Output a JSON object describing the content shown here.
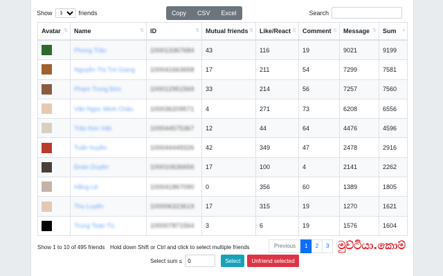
{
  "toolbar": {
    "show_label": "Show",
    "page_size": "10",
    "friends_label": "friends",
    "copy": "Copy",
    "csv": "CSV",
    "excel": "Excel",
    "search_label": "Search",
    "search_value": ""
  },
  "table": {
    "columns": [
      "Avatar",
      "Name",
      "ID",
      "Mutual friends",
      "Like/React",
      "Comment",
      "Message",
      "Sum"
    ],
    "rows": [
      {
        "avatar_color": "#2e6b2a",
        "name": "Phong Trần",
        "id": "100013367684",
        "mutual": "43",
        "like": "116",
        "comment": "19",
        "message": "9021",
        "sum": "9199"
      },
      {
        "avatar_color": "#a0612c",
        "name": "Nguyễn Thị Tơi Giang",
        "id": "100041663658",
        "mutual": "17",
        "like": "211",
        "comment": "54",
        "message": "7299",
        "sum": "7581"
      },
      {
        "avatar_color": "#8c5b3f",
        "name": "Phạm Trung Đức",
        "id": "100012951569",
        "mutual": "33",
        "like": "214",
        "comment": "56",
        "message": "7257",
        "sum": "7560"
      },
      {
        "avatar_color": "#e8c9b0",
        "name": "Văn Ngọc Minh Châu",
        "id": "100036209571",
        "mutual": "4",
        "like": "271",
        "comment": "73",
        "message": "6208",
        "sum": "6556"
      },
      {
        "avatar_color": "#d9d0c2",
        "name": "Trần Kim Việt",
        "id": "100044575367",
        "mutual": "12",
        "like": "44",
        "comment": "64",
        "message": "4476",
        "sum": "4596"
      },
      {
        "avatar_color": "#b83b2b",
        "name": "Tuấn huyền",
        "id": "100044449326",
        "mutual": "42",
        "like": "349",
        "comment": "47",
        "message": "2478",
        "sum": "2916"
      },
      {
        "avatar_color": "#4a4039",
        "name": "Đoàn Duyên",
        "id": "100010636656",
        "mutual": "17",
        "like": "100",
        "comment": "4",
        "message": "2141",
        "sum": "2262"
      },
      {
        "avatar_color": "#c5b3a8",
        "name": "Hằng Lê",
        "id": "100041867090",
        "mutual": "0",
        "like": "356",
        "comment": "60",
        "message": "1389",
        "sum": "1805"
      },
      {
        "avatar_color": "#e3c8b6",
        "name": "Thu Luyến",
        "id": "100006323619",
        "mutual": "17",
        "like": "315",
        "comment": "19",
        "message": "1270",
        "sum": "1621"
      },
      {
        "avatar_color": "#050505",
        "name": "Trung Toàn Tú",
        "id": "100007871564",
        "mutual": "3",
        "like": "6",
        "comment": "19",
        "message": "1576",
        "sum": "1604"
      }
    ]
  },
  "footer": {
    "info": "Show 1 to 10 of 495 friends",
    "hint": "Hold down Shift or Ctrl and click to select multiple friends",
    "previous": "Previous",
    "pages": [
      "1",
      "2",
      "3"
    ],
    "select_sum_label": "Select sum ≤",
    "select_sum_value": "0",
    "select_button": "Select",
    "unfriend_button": "Unfriend selected"
  },
  "watermark": "මුව්ටියා.කොම්"
}
